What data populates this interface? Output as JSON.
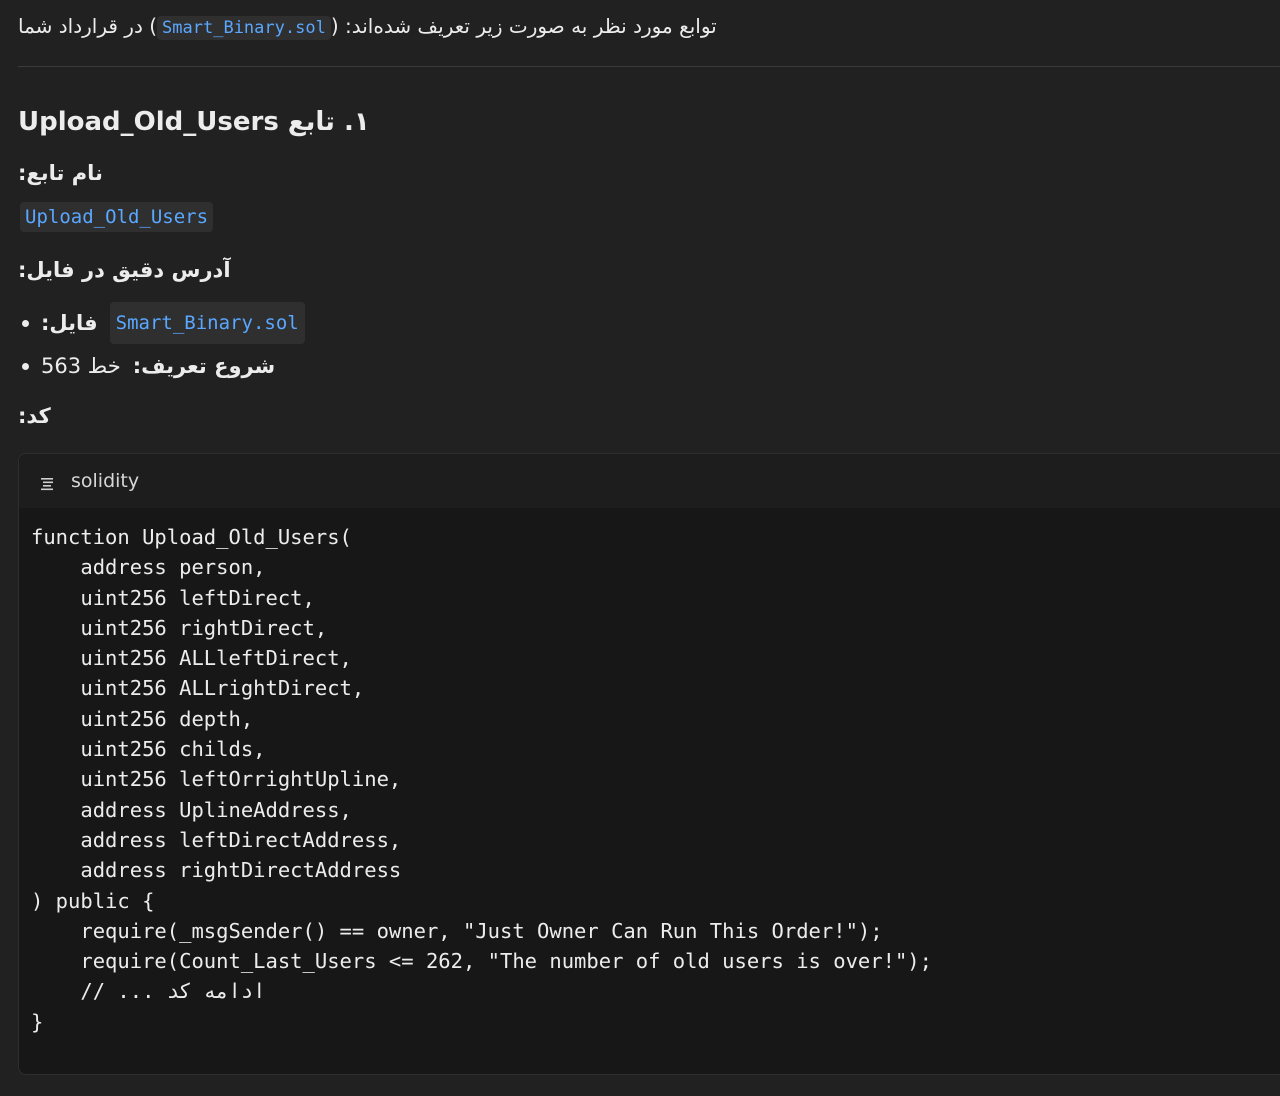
{
  "intro": {
    "prefix": "در قرارداد شما",
    "filename": "Smart_Binary.sol",
    "suffix": "توابع مورد نظر به صورت زیر تعریف شده‌اند:"
  },
  "section": {
    "heading": "۱. تابع Upload_Old_Users",
    "function_name_label": "نام تابع:",
    "function_name": "Upload_Old_Users",
    "address_label": "آدرس دقیق در فایل:",
    "bullets": [
      {
        "label": "فایل:",
        "value": "Smart_Binary.sol"
      },
      {
        "label": "شروع تعریف:",
        "value": "خط 563"
      }
    ],
    "code_label": "کد:"
  },
  "code_block": {
    "language": "solidity",
    "lines": [
      "function Upload_Old_Users(",
      "    address person,",
      "    uint256 leftDirect,",
      "    uint256 rightDirect,",
      "    uint256 ALLleftDirect,",
      "    uint256 ALLrightDirect,",
      "    uint256 depth,",
      "    uint256 childs,",
      "    uint256 leftOrrightUpline,",
      "    address UplineAddress,",
      "    address leftDirectAddress,",
      "    address rightDirectAddress",
      ") public {",
      "    require(_msgSender() == owner, \"Just Owner Can Run This Order!\");",
      "    require(Count_Last_Users <= 262, \"The number of old users is over!\");",
      "    // ... ادامه کد",
      "}"
    ]
  },
  "icons": [
    "code-lines-icon"
  ]
}
